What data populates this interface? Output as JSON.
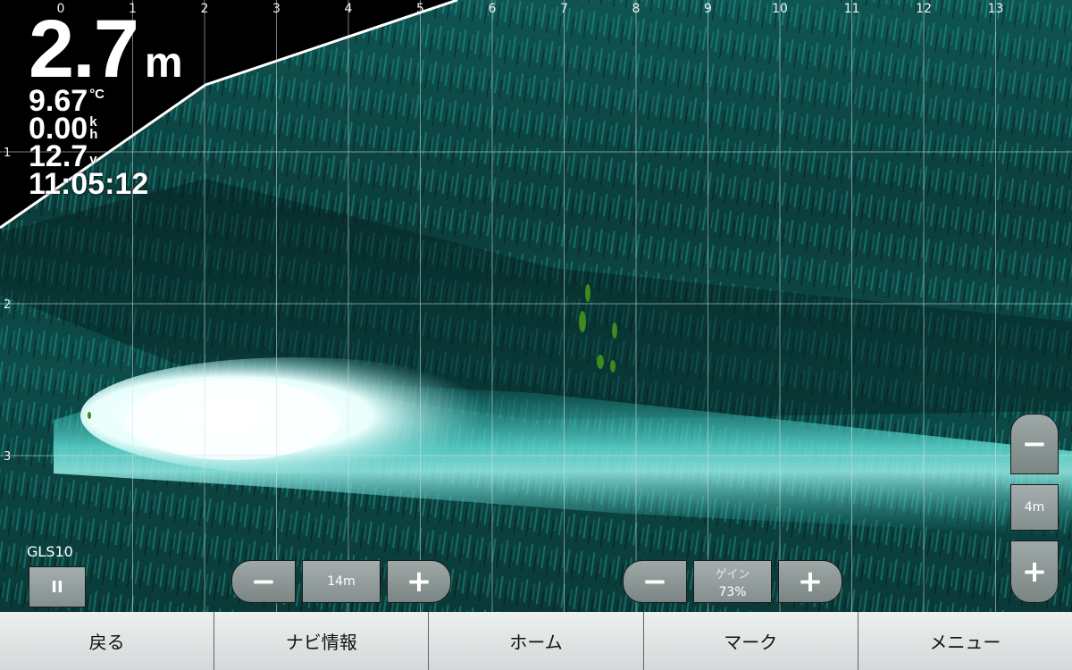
{
  "readout": {
    "depth_value": "2.7",
    "depth_unit": "m",
    "water_temp_value": "9.67",
    "water_temp_unit": "°C",
    "speed_value": "0.00",
    "speed_unit_top": "k",
    "speed_unit_bottom": "h",
    "voltage_value": "12.7",
    "voltage_unit": "v",
    "time": "11:05:12"
  },
  "x_axis_ticks": [
    "0",
    "1",
    "2",
    "3",
    "4",
    "5",
    "6",
    "7",
    "8",
    "9",
    "10",
    "11",
    "12",
    "13"
  ],
  "y_axis_ticks": [
    "1",
    "2",
    "3"
  ],
  "source_label": "GLS10",
  "pause_icon": "pause-icon",
  "range_control": {
    "value": "14m",
    "minus": "−",
    "plus": "+"
  },
  "gain_control": {
    "label": "ゲイン",
    "value": "73%",
    "minus": "−",
    "plus": "+"
  },
  "zoom_control": {
    "value": "4m",
    "minus": "−",
    "plus": "+"
  },
  "colors": {
    "sonar_return": "#17b3ad",
    "strong_return": "#ffffff",
    "fish_marks": "#3e8a1c",
    "background": "#000000"
  },
  "bottom_bar": {
    "back": "戻る",
    "navi_info": "ナビ情報",
    "home": "ホーム",
    "mark": "マーク",
    "menu": "メニュー"
  }
}
